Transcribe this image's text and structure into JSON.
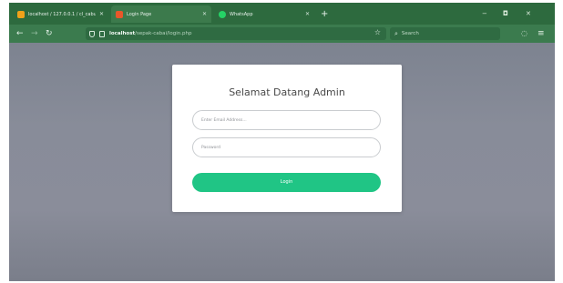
{
  "browser": {
    "tabs": [
      {
        "label": "localhost / 127.0.0.1 / cl_cabu",
        "favicon_color": "#f0a21a",
        "active": false
      },
      {
        "label": "Login Page",
        "favicon_color": "#e8572a",
        "active": true
      },
      {
        "label": "WhatsApp",
        "favicon_color": "#25d366",
        "active": false
      }
    ],
    "new_tab": "+",
    "url_host": "localhost",
    "url_path": "/sepak-cabai/login.php",
    "search_placeholder": "Search",
    "window_controls": {
      "minimize": "−",
      "maximize": "◘",
      "close": "✕"
    }
  },
  "login": {
    "title": "Selamat Datang Admin",
    "email_placeholder": "Enter Email Address...",
    "password_placeholder": "Password",
    "button_label": "Login"
  },
  "colors": {
    "browser_chrome": "#2d6a3e",
    "login_button": "#20c585",
    "page_background": "#868a97"
  }
}
